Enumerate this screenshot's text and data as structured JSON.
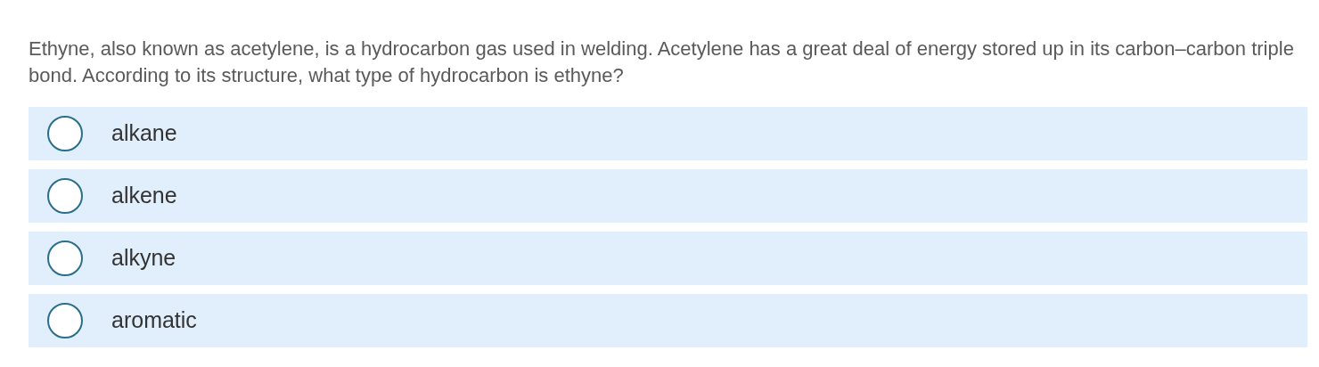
{
  "question": "Ethyne, also known as acetylene, is a hydrocarbon gas used in welding. Acetylene has a great deal of energy stored up in its carbon–carbon triple bond. According to its structure, what type of hydrocarbon is ethyne?",
  "options": [
    {
      "label": "alkane",
      "selected": false
    },
    {
      "label": "alkene",
      "selected": false
    },
    {
      "label": "alkyne",
      "selected": false
    },
    {
      "label": "aromatic",
      "selected": false
    }
  ]
}
